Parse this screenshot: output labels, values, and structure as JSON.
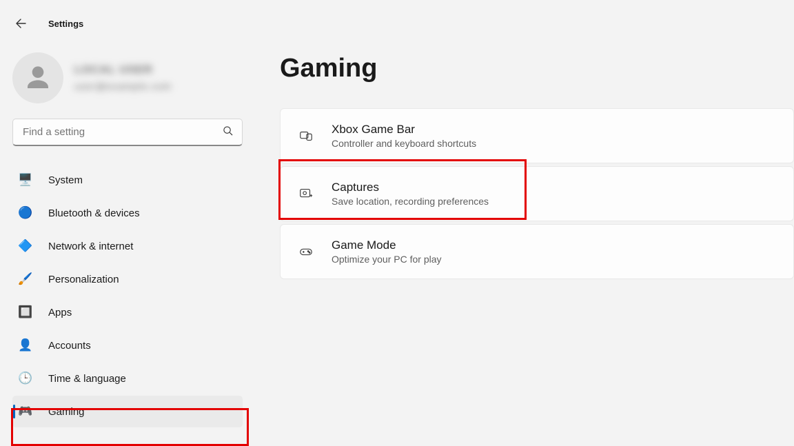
{
  "app": {
    "title": "Settings"
  },
  "profile": {
    "name": "LOCAL USER",
    "email": "user@example.com"
  },
  "search": {
    "placeholder": "Find a setting"
  },
  "sidebar": {
    "items": [
      {
        "label": "System",
        "icon": "🖥️"
      },
      {
        "label": "Bluetooth & devices",
        "icon": "🔵"
      },
      {
        "label": "Network & internet",
        "icon": "🔷"
      },
      {
        "label": "Personalization",
        "icon": "🖌️"
      },
      {
        "label": "Apps",
        "icon": "🔲"
      },
      {
        "label": "Accounts",
        "icon": "👤"
      },
      {
        "label": "Time & language",
        "icon": "🕒"
      },
      {
        "label": "Gaming",
        "icon": "🎮"
      }
    ],
    "active_index": 7
  },
  "page": {
    "title": "Gaming",
    "cards": [
      {
        "title": "Xbox Game Bar",
        "subtitle": "Controller and keyboard shortcuts"
      },
      {
        "title": "Captures",
        "subtitle": "Save location, recording preferences"
      },
      {
        "title": "Game Mode",
        "subtitle": "Optimize your PC for play"
      }
    ]
  }
}
